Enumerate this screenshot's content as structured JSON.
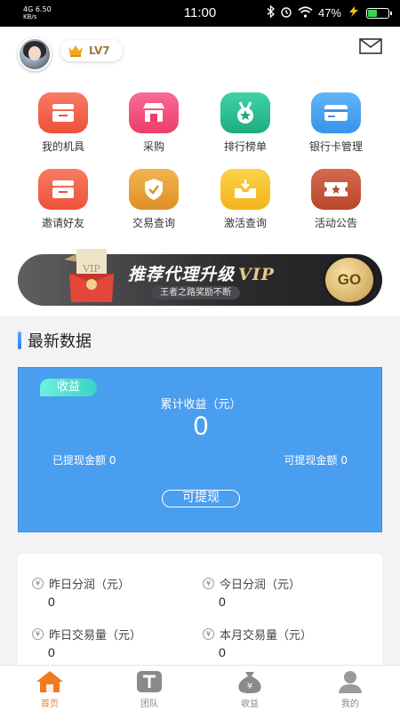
{
  "status_bar": {
    "network": "4G",
    "speed": "6.50",
    "speed_unit": "KB/s",
    "time": "11:00",
    "battery_percent": "47%",
    "battery_level": 0.47
  },
  "header": {
    "level_label": "LV7"
  },
  "grid": {
    "items": [
      {
        "label": "我的机具",
        "icon": "device-icon",
        "color": "#f4644f"
      },
      {
        "label": "采购",
        "icon": "shop-icon",
        "color": "#f2497a"
      },
      {
        "label": "排行榜单",
        "icon": "medal-icon",
        "color": "#2bc195"
      },
      {
        "label": "银行卡管理",
        "icon": "card-icon",
        "color": "#4aa5f2"
      },
      {
        "label": "邀请好友",
        "icon": "invite-icon",
        "color": "#f4644f"
      },
      {
        "label": "交易查询",
        "icon": "shield-icon",
        "color": "#eaa23a"
      },
      {
        "label": "激活查询",
        "icon": "download-tray-icon",
        "color": "#f7c12f"
      },
      {
        "label": "活动公告",
        "icon": "ticket-icon",
        "color": "#c7563b"
      }
    ]
  },
  "banner": {
    "title": "推荐代理升级",
    "title_vip": "VIP",
    "subtitle": "王者之路奖励不断",
    "go_label": "GO",
    "gift_label": "VIP"
  },
  "section": {
    "title": "最新数据"
  },
  "earnings": {
    "tag": "收益",
    "caption": "累计收益（元）",
    "total": "0",
    "withdrawn": "已提现金额 0",
    "withdrawable_amount": "可提现金额 0",
    "withdraw_button": "可提现"
  },
  "stats": [
    {
      "label": "昨日分润（元）",
      "value": "0"
    },
    {
      "label": "今日分润（元）",
      "value": "0"
    },
    {
      "label": "昨日交易量（元）",
      "value": "0"
    },
    {
      "label": "本月交易量（元）",
      "value": "0"
    }
  ],
  "tabbar": {
    "tabs": [
      {
        "label": "首页",
        "icon": "home-icon",
        "active": true
      },
      {
        "label": "团队",
        "icon": "team-icon",
        "active": false
      },
      {
        "label": "收益",
        "icon": "money-bag-icon",
        "active": false
      },
      {
        "label": "我的",
        "icon": "profile-icon",
        "active": false
      }
    ]
  },
  "colors": {
    "accent_blue": "#4a9ef0",
    "tab_active": "#f07a1f"
  }
}
